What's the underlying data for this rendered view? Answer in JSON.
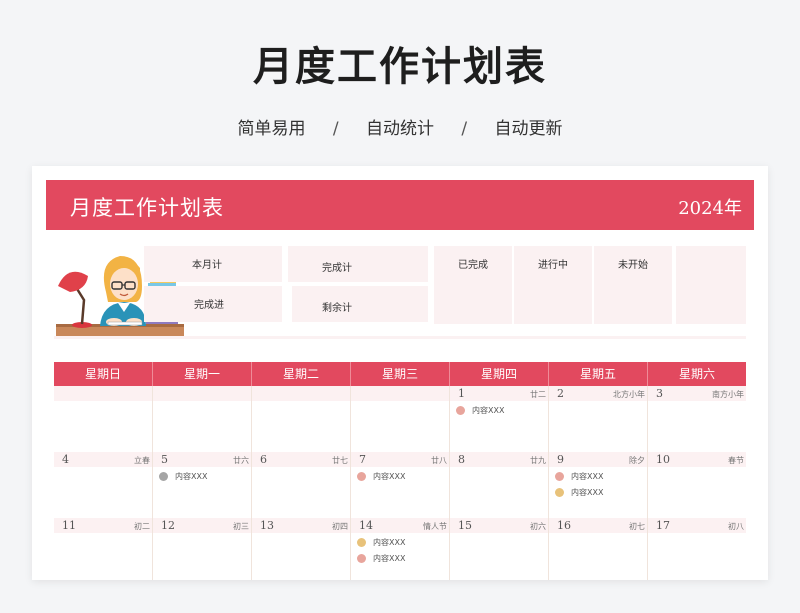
{
  "page": {
    "title": "月度工作计划表",
    "features": [
      "简单易用",
      "自动统计",
      "自动更新"
    ],
    "separator": "/"
  },
  "sheet": {
    "title": "月度工作计划表",
    "year": "2024年",
    "stats": {
      "month_total": "本月计",
      "done_total": "完成计",
      "progress": "完成进",
      "remaining": "剩余计",
      "completed": "已完成",
      "in_progress": "进行中",
      "not_started": "未开始"
    }
  },
  "colors": {
    "accent": "#e2495f",
    "dot_red": "#e8a59c",
    "dot_gray": "#a5a5a5",
    "dot_yellow": "#e8c27a"
  },
  "calendar": {
    "weekdays": [
      "星期日",
      "星期一",
      "星期二",
      "星期三",
      "星期四",
      "星期五",
      "星期六"
    ],
    "weeks": [
      [
        {
          "day": "",
          "lunar": "",
          "tasks": []
        },
        {
          "day": "",
          "lunar": "",
          "tasks": []
        },
        {
          "day": "",
          "lunar": "",
          "tasks": []
        },
        {
          "day": "",
          "lunar": "",
          "tasks": []
        },
        {
          "day": "1",
          "lunar": "廿二",
          "tasks": [
            {
              "text": "内容XXX",
              "status": "red"
            }
          ]
        },
        {
          "day": "2",
          "lunar": "北方小年",
          "tasks": []
        },
        {
          "day": "3",
          "lunar": "南方小年",
          "tasks": []
        }
      ],
      [
        {
          "day": "4",
          "lunar": "立春",
          "tasks": []
        },
        {
          "day": "5",
          "lunar": "廿六",
          "tasks": [
            {
              "text": "内容XXX",
              "status": "gray"
            }
          ]
        },
        {
          "day": "6",
          "lunar": "廿七",
          "tasks": []
        },
        {
          "day": "7",
          "lunar": "廿八",
          "tasks": [
            {
              "text": "内容XXX",
              "status": "red"
            }
          ]
        },
        {
          "day": "8",
          "lunar": "廿九",
          "tasks": []
        },
        {
          "day": "9",
          "lunar": "除夕",
          "tasks": [
            {
              "text": "内容XXX",
              "status": "red"
            },
            {
              "text": "内容XXX",
              "status": "yellow"
            }
          ]
        },
        {
          "day": "10",
          "lunar": "春节",
          "tasks": []
        }
      ],
      [
        {
          "day": "11",
          "lunar": "初二",
          "tasks": []
        },
        {
          "day": "12",
          "lunar": "初三",
          "tasks": []
        },
        {
          "day": "13",
          "lunar": "初四",
          "tasks": []
        },
        {
          "day": "14",
          "lunar": "情人节",
          "tasks": [
            {
              "text": "内容XXX",
              "status": "yellow"
            },
            {
              "text": "内容XXX",
              "status": "red"
            }
          ]
        },
        {
          "day": "15",
          "lunar": "初六",
          "tasks": []
        },
        {
          "day": "16",
          "lunar": "初七",
          "tasks": []
        },
        {
          "day": "17",
          "lunar": "初八",
          "tasks": []
        }
      ]
    ]
  }
}
